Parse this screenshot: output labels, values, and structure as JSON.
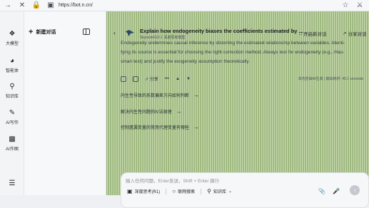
{
  "browser": {
    "url": "https://bot.n.cn/",
    "icons": [
      "back-arrow-icon",
      "close-icon",
      "lock-icon",
      "site-icon",
      "star-icon",
      "shield-icon"
    ]
  },
  "rail": {
    "items": [
      {
        "label": "大模型",
        "icon": "model-icon"
      },
      {
        "label": "智能体",
        "icon": "agent-icon"
      },
      {
        "label": "知识库",
        "icon": "knowledge-icon"
      },
      {
        "label": "AI写作",
        "icon": "pen-icon"
      },
      {
        "label": "AI作图",
        "icon": "image-icon"
      }
    ]
  },
  "panel": {
    "new_chat": "新建对话"
  },
  "main": {
    "title": "Explain how endogeneity biases the coefficients estimated by ...",
    "subtitle": "Skywork/GX-1 深度思考模型",
    "new_chat_btn": "开启新对话",
    "share_btn": "分享对话",
    "body_lines": [
      "Endogeneity undermines causal inference by distorting the estimated relationship between variables. Identi-",
      "fying its source is essential for choosing the right correction method. Always test for endogeneity (e.g., Hau-",
      "sman test) and justify the exogeneity assumption theoretically."
    ],
    "share_label": "分享",
    "meta_right": "本内容由AI生成 | 输出耗时: 45.1 seconds"
  },
  "suggestions": [
    "内生性导致的系数偏差方向如何判断",
    "解决内生性问题的IV法原理",
    "控制遗漏变量的常用代理变量有哪些"
  ],
  "composer": {
    "placeholder": "输入任何问题，Enter发送，Shift + Enter 换行",
    "deep_think": "深度思考(R1)",
    "web_search": "联网搜索",
    "knowledge": "知识库"
  }
}
